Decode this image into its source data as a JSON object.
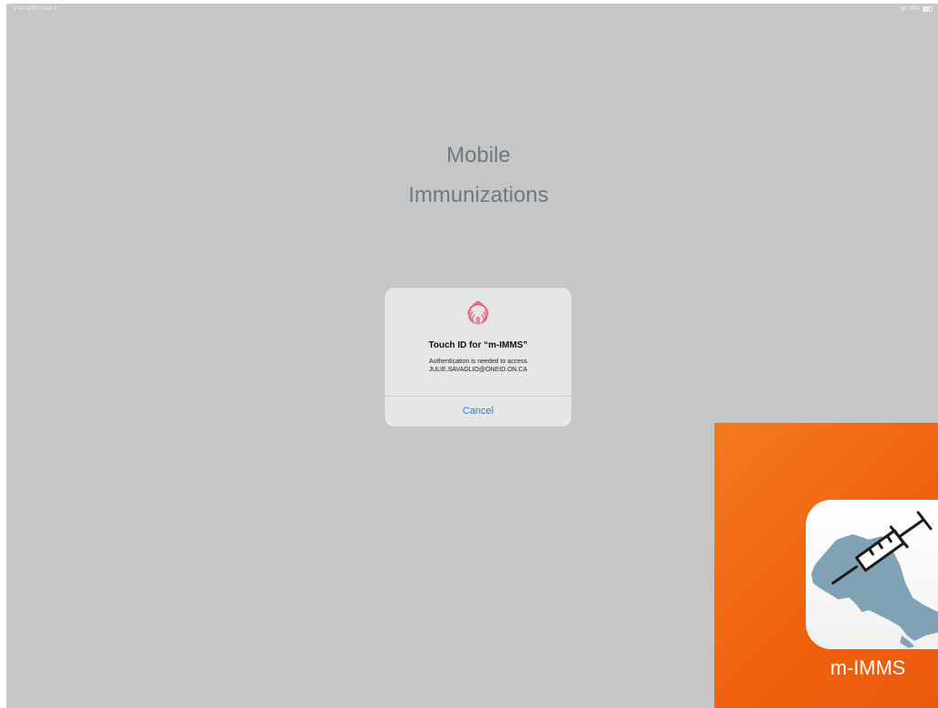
{
  "status_bar": {
    "time_date": "8:44 AM  Fri Mar 4",
    "battery_percent": "80%",
    "battery_level": 0.8
  },
  "app_title": {
    "line1": "Mobile",
    "line2": "Immunizations"
  },
  "touch_id_alert": {
    "icon": "fingerprint-icon",
    "title": "Touch ID for “m-IMMS”",
    "message_line1": "Authentication is needed to access",
    "message_line2": "JULIE.SAVAGLIO@ONEID.ON.CA",
    "cancel_label": "Cancel"
  },
  "app_tile": {
    "icon": "syringe-ontario-icon",
    "label": "m-IMMS"
  },
  "colors": {
    "background": "#c6c6c6",
    "title_text": "#6b7a82",
    "alert_bg": "#e6e6e6",
    "link_blue": "#2f7fd6",
    "fingerprint_pink": "#e8577a",
    "tile_orange": "#f0620f",
    "map_blue": "#7fa2b5"
  }
}
